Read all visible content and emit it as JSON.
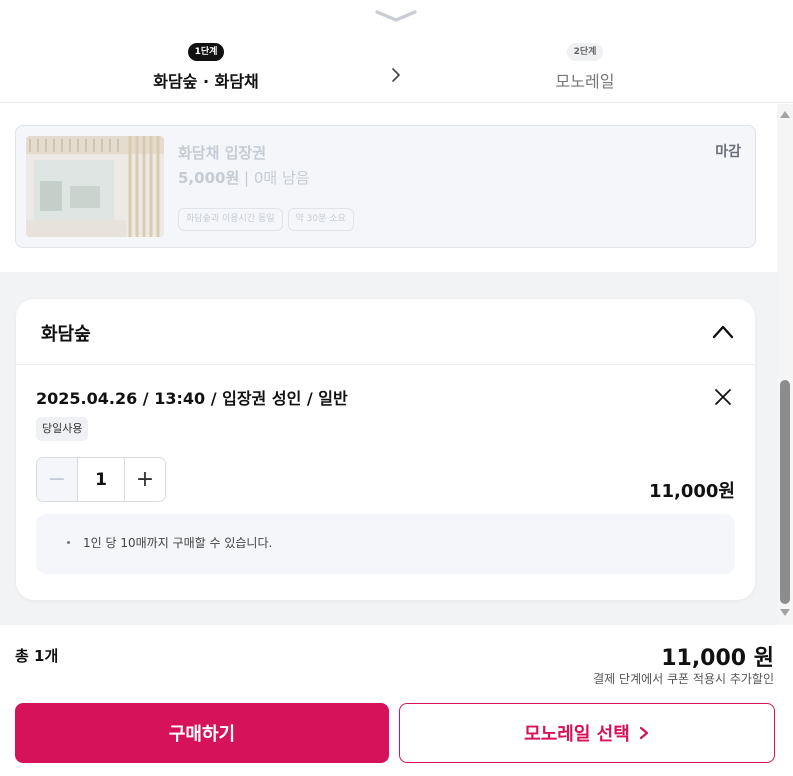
{
  "steps": [
    {
      "badge": "1단계",
      "label": "화담숲 · 화담채",
      "active": true
    },
    {
      "badge": "2단계",
      "label": "모노레일",
      "active": false
    }
  ],
  "ticket": {
    "name": "화담채 입장권",
    "price": "5,000원",
    "separator": " | ",
    "remaining": "0매 남음",
    "tags": [
      "화담숲과 이용시간 동일",
      "약 30분 소요"
    ],
    "status": "마감"
  },
  "selection": {
    "title": "화담숲",
    "item": "2025.04.26 / 13:40 / 입장권 성인 / 일반",
    "badge": "당일사용",
    "quantity": "1",
    "minus": "−",
    "plus": "+",
    "price": "11,000원",
    "notice": "1인 당 10매까지 구매할 수 있습니다."
  },
  "footer": {
    "total_count": "총 1개",
    "total_price": "11,000 원",
    "coupon_note": "결제 단계에서 쿠폰 적용시 추가할인",
    "buy_label": "구매하기",
    "monorail_label": "모노레일 선택"
  },
  "colors": {
    "accent": "#d6135a",
    "disabled_text": "#c6ccd5",
    "panel_bg": "#f2f3f5"
  },
  "icons": [
    "chevron-down-icon",
    "chevron-right-icon",
    "chevron-up-icon",
    "close-icon"
  ]
}
